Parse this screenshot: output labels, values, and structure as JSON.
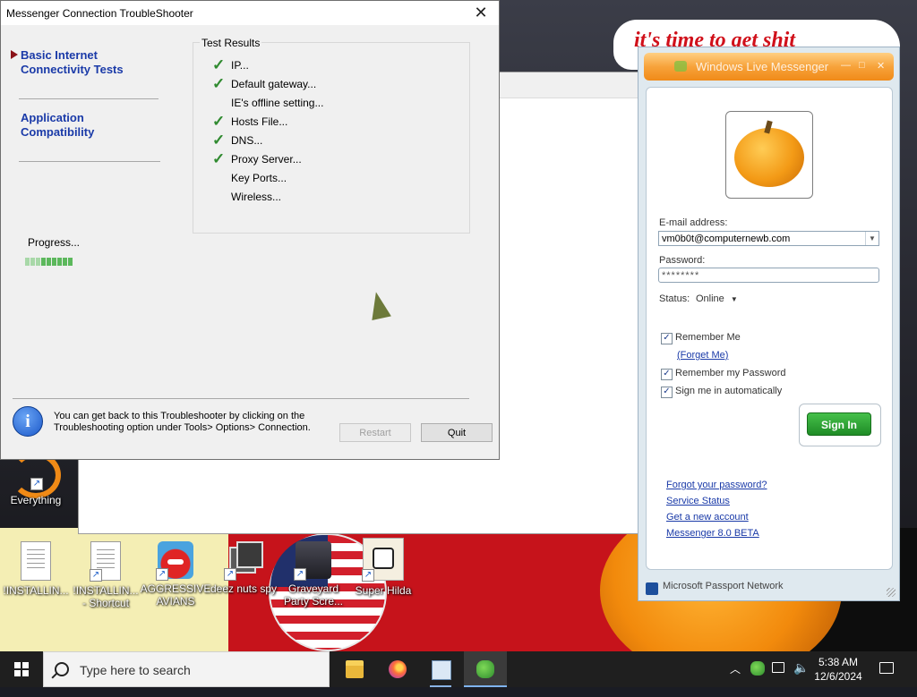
{
  "desktop": {
    "wallpaper_text": "it's time to get shit",
    "icons": [
      {
        "label": "Everything",
        "icon": "everything-icon"
      },
      {
        "label": "!INSTALLIN...",
        "icon": "document-icon"
      },
      {
        "label": "!INSTALLIN... - Shortcut",
        "icon": "document-shortcut-icon"
      },
      {
        "label": "AGGRESSIVE AVIANS",
        "icon": "angry-bird-icon"
      },
      {
        "label": "deez nuts spy",
        "icon": "stacked-windows-icon"
      },
      {
        "label": "Graveyard Party Scre...",
        "icon": "graveyard-icon"
      },
      {
        "label": "Super Hilda",
        "icon": "pixel-character-icon"
      }
    ]
  },
  "troubleshooter": {
    "title": "Messenger Connection TroubleShooter",
    "nav": [
      "Basic Internet Connectivity Tests",
      "Application Compatibility"
    ],
    "group_title": "Test Results",
    "tests": [
      {
        "label": "IP...",
        "passed": true
      },
      {
        "label": "Default gateway...",
        "passed": true
      },
      {
        "label": "IE's offline setting...",
        "passed": false
      },
      {
        "label": "Hosts File...",
        "passed": true
      },
      {
        "label": "DNS...",
        "passed": true
      },
      {
        "label": "Proxy Server...",
        "passed": true
      },
      {
        "label": "Key Ports...",
        "passed": false
      },
      {
        "label": "Wireless...",
        "passed": false
      }
    ],
    "progress_label": "Progress...",
    "progress_fraction": 0.75,
    "info_text": "You can get back to this Troubleshooter by clicking on the Troubleshooting option under Tools> Options> Connection.",
    "restart_label": "Restart",
    "quit_label": "Quit",
    "check_color": "#2f8a2f"
  },
  "messenger": {
    "title": "Windows Live Messenger",
    "email_label": "E-mail address:",
    "email_value": "vm0b0t@computernewb.com",
    "password_label": "Password:",
    "password_value": "********",
    "status_label": "Status:",
    "status_value": "Online",
    "remember_me": "Remember Me",
    "forget_me": "(Forget Me)",
    "remember_password": "Remember my Password",
    "sign_in_auto": "Sign me in automatically",
    "sign_in": "Sign In",
    "links": [
      "Forgot your password?",
      "Service Status",
      "Get a new account",
      "Messenger 8.0 BETA"
    ],
    "footer": "Microsoft Passport Network",
    "accent": "#f08a18"
  },
  "taskbar": {
    "search_placeholder": "Type here to search",
    "time": "5:38 AM",
    "date": "12/6/2024"
  }
}
